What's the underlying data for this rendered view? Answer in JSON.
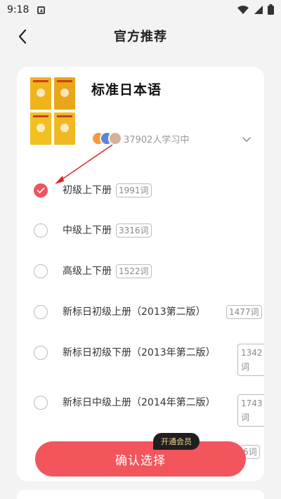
{
  "status_bar": {
    "time": "9:18"
  },
  "nav": {
    "title": "官方推荐"
  },
  "book": {
    "title": "标准日本语",
    "learners": "37902人学习中"
  },
  "options": [
    {
      "label": "初级上下册",
      "count": "1991词",
      "checked": true
    },
    {
      "label": "中级上下册",
      "count": "3316词",
      "checked": false
    },
    {
      "label": "高级上下册",
      "count": "1522词",
      "checked": false
    },
    {
      "label": "新标日初级上册（2013第二版）",
      "count": "1477词",
      "checked": false
    },
    {
      "label": "新标日初级下册（2013年第二版）",
      "count": "1342词",
      "checked": false
    },
    {
      "label": "新标日中级上册（2014年第二版）",
      "count": "1743词",
      "checked": false
    },
    {
      "label": "",
      "count": "6词",
      "checked": false
    }
  ],
  "confirm": {
    "label": "确认选择"
  },
  "vip": {
    "label": "开通会员"
  },
  "colors": {
    "accent": "#f3555d",
    "annotation_arrow": "#d62828"
  }
}
